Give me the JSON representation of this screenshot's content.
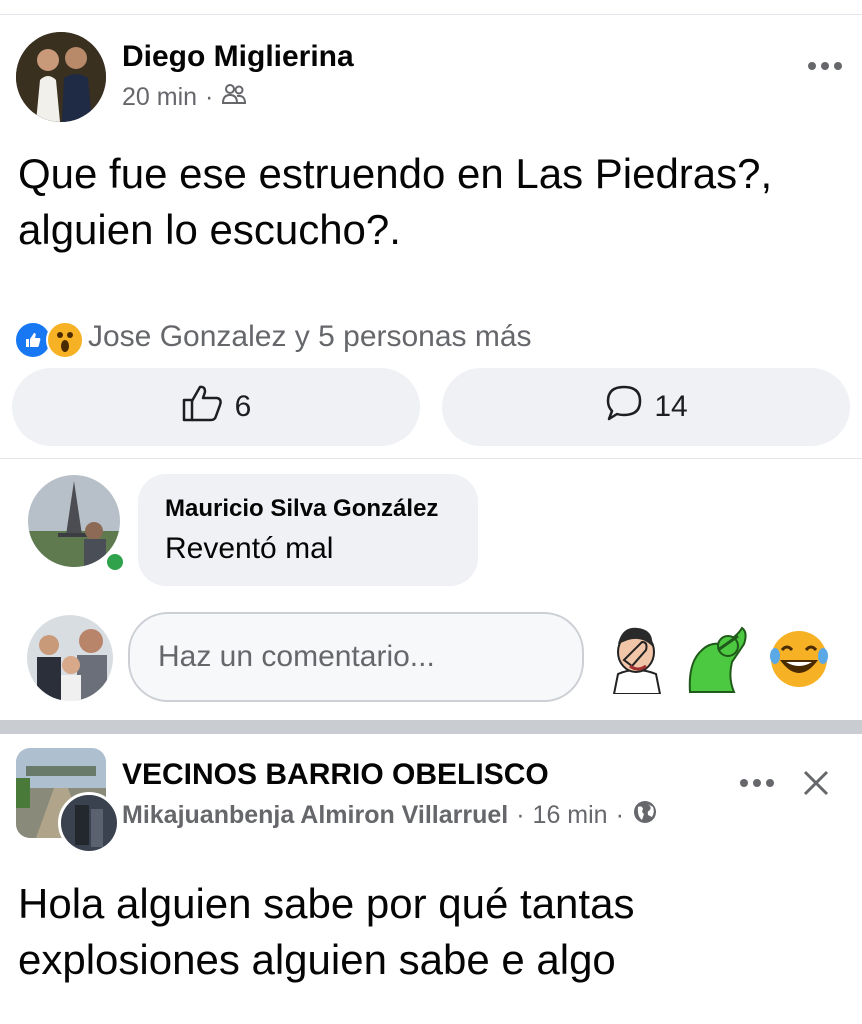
{
  "post1": {
    "author": "Diego Miglierina",
    "time": "20 min",
    "separator": "·",
    "audience_icon": "friends-icon",
    "text": "Que fue ese estruendo en Las Piedras?, alguien lo escucho?.",
    "reactions_summary": "Jose Gonzalez y 5 personas más",
    "like_count": "6",
    "comment_count": "14"
  },
  "comment": {
    "author": "Mauricio Silva González",
    "text": "Reventó mal"
  },
  "composer": {
    "placeholder": "Haz un comentario..."
  },
  "post2": {
    "group": "VECINOS BARRIO OBELISCO",
    "author": "Mikajuanbenja Almiron Villarruel",
    "sep1": "·",
    "time": "16 min",
    "sep2": "·",
    "audience_icon": "globe-icon",
    "text": "Hola alguien sabe por qué tantas explosiones alguien sabe e algo"
  },
  "colors": {
    "like_blue": "#1877f2",
    "online_green": "#31a24c",
    "wow_yellow": "#f7b125"
  }
}
